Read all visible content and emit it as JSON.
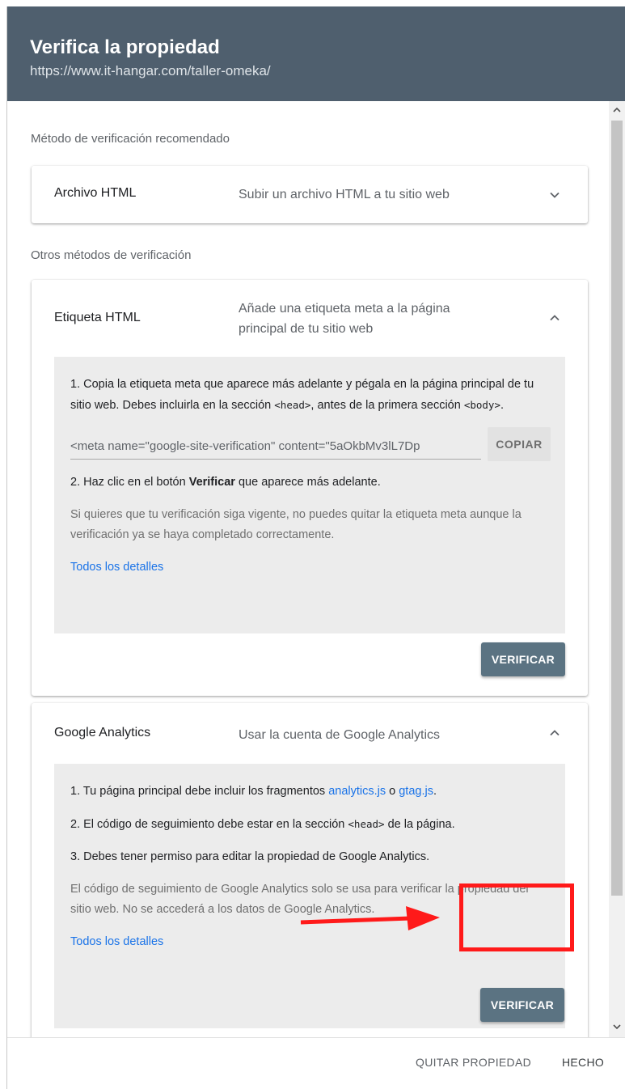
{
  "header": {
    "title": "Verifica la propiedad",
    "url": "https://www.it-hangar.com/taller-omeka/"
  },
  "recommended": {
    "label": "Método de verificación recomendado",
    "method": {
      "name": "Archivo HTML",
      "description": "Subir un archivo HTML a tu sitio web",
      "icon": "chevron-down-icon"
    }
  },
  "other": {
    "label": "Otros métodos de verificación"
  },
  "html_tag": {
    "name": "Etiqueta HTML",
    "description": "Añade una etiqueta meta a la página principal de tu sitio web",
    "icon": "chevron-up-icon",
    "step1_a": "1. Copia la etiqueta meta que aparece más adelante y pégala en la página principal de tu sitio web. Debes incluirla en la sección ",
    "step1_head": "<head>",
    "step1_b": ", antes de la primera sección ",
    "step1_body": "<body>",
    "step1_c": ".",
    "meta_value": "<meta name=\"google-site-verification\" content=\"5aOkbMv3lL7Dp",
    "copy_label": "COPIAR",
    "step2_a": "2. Haz clic en el botón ",
    "step2_bold": "Verificar",
    "step2_b": " que aparece más adelante.",
    "note": "Si quieres que tu verificación siga vigente, no puedes quitar la etiqueta meta aunque la verificación ya se haya completado correctamente.",
    "details_link": "Todos los detalles",
    "verify_label": "VERIFICAR"
  },
  "analytics": {
    "name": "Google Analytics",
    "description": "Usar la cuenta de Google Analytics",
    "icon": "chevron-up-icon",
    "step1_a": "1. Tu página principal debe incluir los fragmentos ",
    "step1_link1": "analytics.js",
    "step1_or": " o ",
    "step1_link2": "gtag.js",
    "step1_end": ".",
    "step2_a": "2. El código de seguimiento debe estar en la sección ",
    "step2_head": "<head>",
    "step2_b": " de la página.",
    "step3": "3. Debes tener permiso para editar la propiedad de Google Analytics.",
    "note": "El código de seguimiento de Google Analytics solo se usa para verificar la propiedad del sitio web. No se accederá a los datos de Google Analytics.",
    "details_link": "Todos los detalles",
    "verify_label": "VERIFICAR"
  },
  "footer": {
    "remove_label": "QUITAR PROPIEDAD",
    "done_label": "HECHO"
  },
  "colors": {
    "header_bg": "#4f5f6e",
    "link": "#1a73e8",
    "verify_button": "#5b7382",
    "annotation": "#ff1a1a"
  }
}
